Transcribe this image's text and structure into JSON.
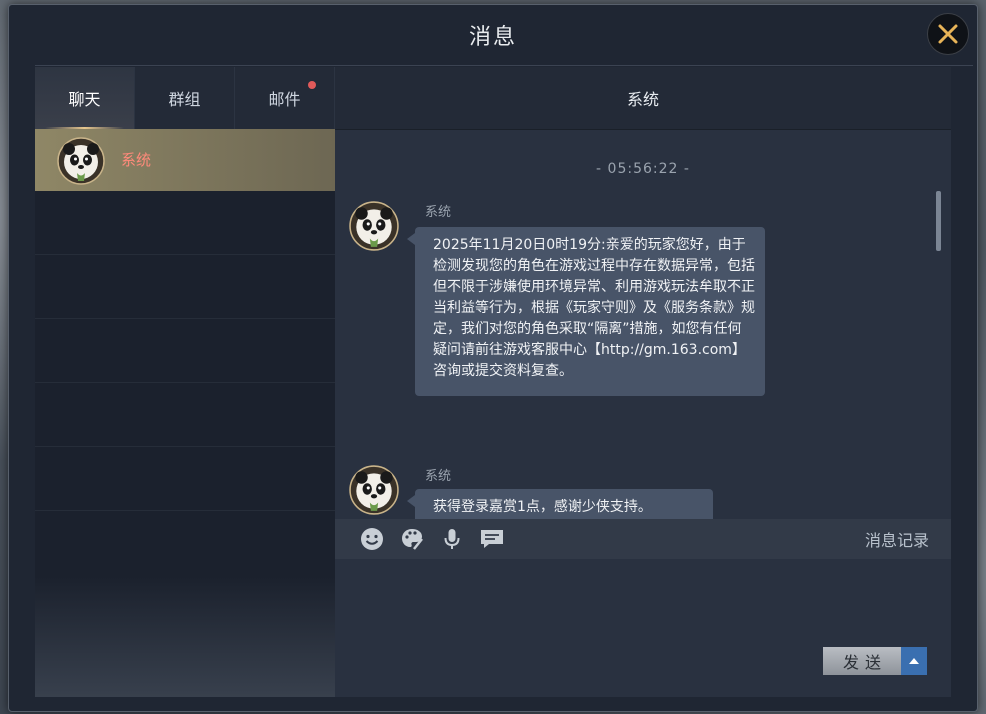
{
  "window": {
    "title": "消息"
  },
  "tabs": [
    {
      "label": "聊天",
      "active": true
    },
    {
      "label": "群组",
      "active": false
    },
    {
      "label": "邮件",
      "active": false,
      "badge": true
    }
  ],
  "contacts": [
    {
      "name": "系统",
      "selected": true,
      "avatar_icon": "panda-avatar-icon"
    }
  ],
  "chat": {
    "header": "系统",
    "timestamp": "- 05:56:22 -",
    "messages": [
      {
        "sender": "系统",
        "text": "2025年11月20日0时19分:亲爱的玩家您好，由于检测发现您的角色在游戏过程中存在数据异常，包括但不限于涉嫌使用环境异常、利用游戏玩法牟取不正当利益等行为，根据《玩家守则》及《服务条款》规定，我们对您的角色采取“隔离”措施，如您有任何疑问请前往游戏客服中心【http://gm.163.com】咨询或提交资料复查。"
      },
      {
        "sender": "系统",
        "text": "获得登录嘉赏1点，感谢少侠支持。"
      }
    ]
  },
  "toolbar": {
    "icons": [
      "emoji-icon",
      "palette-icon",
      "microphone-icon",
      "chat-bubble-icon"
    ],
    "history_label": "消息记录"
  },
  "input": {
    "send_label": "发送"
  },
  "colors": {
    "window_bg": "#1f2633",
    "bubble_bg": "#485468",
    "contact_name": "#ff8a7a",
    "send_arrow": "#3a6fb0",
    "close_icon": "#e8b458"
  }
}
